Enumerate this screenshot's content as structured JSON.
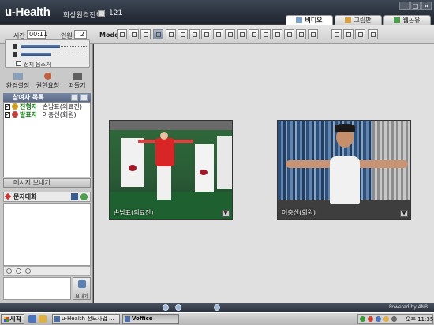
{
  "app": {
    "title": "u-Health",
    "subtitle": "화상원격진료",
    "room_number": "121"
  },
  "window_buttons": [
    "_",
    "□",
    "×"
  ],
  "top_tabs": [
    {
      "label": "비디오",
      "active": true
    },
    {
      "label": "그림판",
      "active": false
    },
    {
      "label": "웹공유",
      "active": false
    }
  ],
  "controls": {
    "time_label": "시간",
    "time_value": "00:11",
    "count_label": "인원",
    "count_value": "2",
    "mode_label": "Mode"
  },
  "volume": {
    "speaker_level": 0.6,
    "mic_level": 0.45,
    "mute_all_label": "전체 음소거"
  },
  "actions": [
    {
      "label": "환경설정",
      "icon": "settings-icon"
    },
    {
      "label": "권한요청",
      "icon": "user-request-icon"
    },
    {
      "label": "떠들기",
      "icon": "megaphone-icon"
    }
  ],
  "participants": {
    "header": "참여자 목록",
    "rows": [
      {
        "role": "진행자",
        "name": "손남표(의료진)",
        "role_color": "#1b7a1b"
      },
      {
        "role": "발표자",
        "name": "이충선(회원)",
        "role_color": "#1b7a1b"
      }
    ],
    "send_message_label": "메시지 보내기"
  },
  "chat": {
    "header": "문자대화",
    "send_label": "보내기"
  },
  "videos": [
    {
      "label": "손남표(의료진)"
    },
    {
      "label": "이충선(회원)"
    }
  ],
  "footer": {
    "powered_by": "Powered by 4NB"
  },
  "taskbar": {
    "start_label": "시작",
    "tasks": [
      {
        "label": "u-Health 선도사업 ...",
        "active": false
      },
      {
        "label": "Voffice",
        "active": true
      }
    ],
    "clock": "오후 11:35"
  }
}
